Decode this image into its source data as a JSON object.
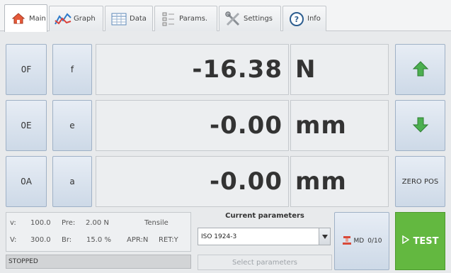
{
  "tabs": [
    {
      "label": "Main",
      "icon": "home-icon",
      "active": true
    },
    {
      "label": "Graph",
      "icon": "graph-icon"
    },
    {
      "label": "Data",
      "icon": "table-icon"
    },
    {
      "label": "Params.",
      "icon": "list-icon"
    },
    {
      "label": "Settings",
      "icon": "tools-icon"
    },
    {
      "label": "Info",
      "icon": "info-icon"
    }
  ],
  "rows": [
    {
      "code": "0F",
      "letter": "f",
      "value": "-16.38",
      "unit": "N"
    },
    {
      "code": "0E",
      "letter": "e",
      "value": "-0.00",
      "unit": "mm"
    },
    {
      "code": "0A",
      "letter": "a",
      "value": "-0.00",
      "unit": "mm"
    }
  ],
  "side": {
    "up": "arrow-up-icon",
    "down": "arrow-down-icon",
    "zero_pos": "ZERO POS"
  },
  "stats": {
    "v1_label": "v:",
    "v1_value": "100.0",
    "pre_label": "Pre:",
    "pre_value": "2.00 N",
    "mode": "Tensile",
    "v2_label": "V:",
    "v2_value": "300.0",
    "br_label": "Br:",
    "br_value": "15.0 %",
    "apr": "APR:N",
    "ret": "RET:Y"
  },
  "status": "STOPPED",
  "params": {
    "title": "Current parameters",
    "selected": "ISO 1924-3",
    "select_button": "Select parameters"
  },
  "md": {
    "label": "MD",
    "count": "0/10"
  },
  "test": {
    "label": "TEST"
  },
  "colors": {
    "accent_green": "#63b840",
    "arrow_green": "#4caf50"
  }
}
